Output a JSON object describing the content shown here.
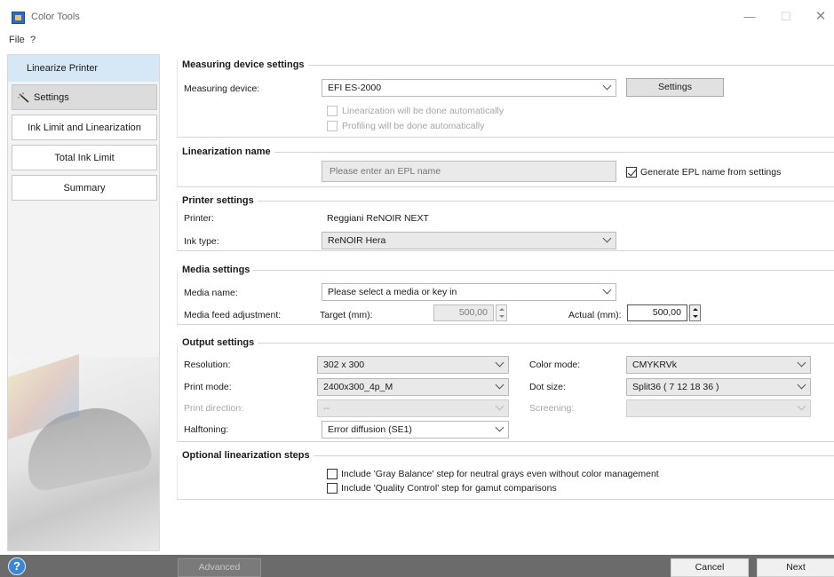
{
  "window": {
    "title": "Color Tools",
    "controls": {
      "minimize": "—",
      "maximize": "☐",
      "close": "✕"
    }
  },
  "menu": [
    "File",
    "?"
  ],
  "sidebar": {
    "header": "Linearize Printer",
    "items": [
      {
        "label": "Settings",
        "icon": "wand-icon"
      },
      {
        "label": "Ink Limit and Linearization"
      },
      {
        "label": "Total Ink Limit"
      },
      {
        "label": "Summary"
      }
    ]
  },
  "measuring": {
    "title": "Measuring device settings",
    "device_label": "Measuring device:",
    "device_value": "EFI ES-2000",
    "settings_button": "Settings",
    "auto_linearization": "Linearization will be done automatically",
    "auto_profiling": "Profiling will be done automatically"
  },
  "linearization": {
    "title": "Linearization name",
    "placeholder": "Please enter an EPL name",
    "generate_label": "Generate EPL name from settings",
    "generate_checked": true
  },
  "printer": {
    "title": "Printer settings",
    "printer_label": "Printer:",
    "printer_value": "Reggiani ReNOIR NEXT",
    "ink_label": "Ink type:",
    "ink_value": "ReNOIR Hera"
  },
  "media": {
    "title": "Media settings",
    "name_label": "Media name:",
    "name_value": "Please select a media or key in",
    "feed_label": "Media feed adjustment:",
    "target_label": "Target (mm):",
    "target_value": "500,00",
    "actual_label": "Actual (mm):",
    "actual_value": "500,00"
  },
  "output": {
    "title": "Output settings",
    "resolution_label": "Resolution:",
    "resolution_value": "302 x 300",
    "color_mode_label": "Color mode:",
    "color_mode_value": "CMYKRVk",
    "print_mode_label": "Print mode:",
    "print_mode_value": "2400x300_4p_M",
    "dot_size_label": "Dot size:",
    "dot_size_value": "Split36  ( 7 12 18 36 )",
    "print_direction_label": "Print direction:",
    "print_direction_value": "--",
    "screening_label": "Screening:",
    "screening_value": "",
    "halftoning_label": "Halftoning:",
    "halftoning_value": "Error diffusion (SE1)"
  },
  "optional": {
    "title": "Optional linearization steps",
    "gray_balance": "Include 'Gray Balance' step for neutral grays even without color management",
    "quality_control": "Include 'Quality Control' step for gamut comparisons"
  },
  "footer": {
    "help": "?",
    "advanced": "Advanced",
    "cancel": "Cancel",
    "next": "Next"
  },
  "colors": {
    "sidebar_active": "#d6e7f6",
    "footer_bg": "#6b6b6b",
    "help_blue": "#3b86d6"
  }
}
